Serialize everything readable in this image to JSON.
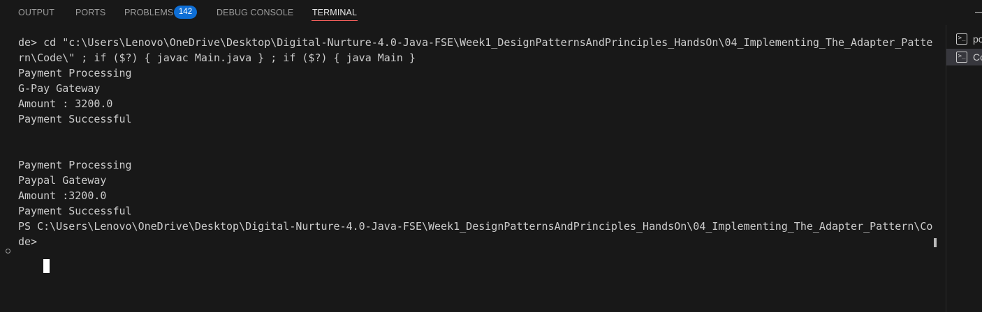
{
  "tabs": [
    {
      "label": "OUTPUT"
    },
    {
      "label": "PORTS"
    },
    {
      "label": "PROBLEMS"
    },
    {
      "label": "DEBUG CONSOLE"
    },
    {
      "label": "TERMINAL"
    }
  ],
  "problems_count": "142",
  "active_tab": "TERMINAL",
  "terminal": {
    "lines": [
      "de> cd \"c:\\Users\\Lenovo\\OneDrive\\Desktop\\Digital-Nurture-4.0-Java-FSE\\Week1_DesignPatternsAndPrinciples_HandsOn\\04_Implementing_The_Adapter_Patte",
      "rn\\Code\\\" ; if ($?) { javac Main.java } ; if ($?) { java Main }",
      "Payment Processing",
      "G-Pay Gateway",
      "Amount : 3200.0",
      "Payment Successful",
      "",
      "",
      "Payment Processing",
      "Paypal Gateway",
      "Amount :3200.0",
      "Payment Successful",
      "PS C:\\Users\\Lenovo\\OneDrive\\Desktop\\Digital-Nurture-4.0-Java-FSE\\Week1_DesignPatternsAndPrinciples_HandsOn\\04_Implementing_The_Adapter_Pattern\\Co",
      "de> "
    ]
  },
  "side_panel": {
    "items": [
      {
        "label": "po",
        "icon": "terminal-icon"
      },
      {
        "label": "Co",
        "icon": "terminal-icon"
      }
    ]
  },
  "colors": {
    "background": "#181818",
    "text": "#cccccc",
    "active_tab_underline": "#f25f5c",
    "badge": "#0e6ed5"
  }
}
